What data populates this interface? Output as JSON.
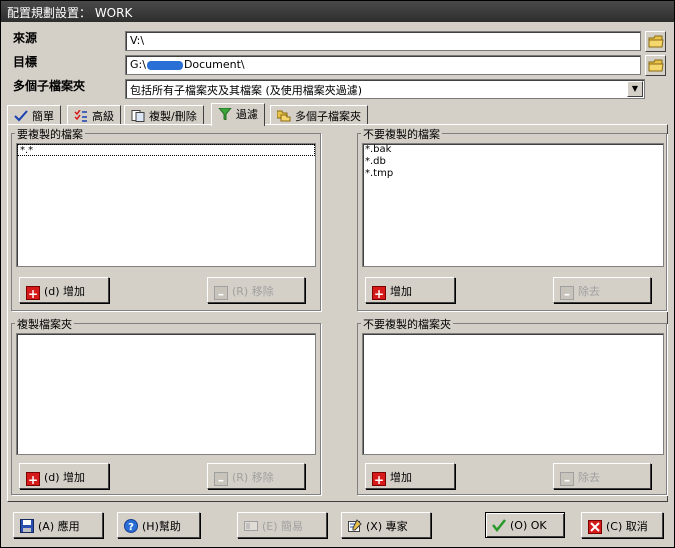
{
  "window": {
    "title": "配置規劃設置： WORK"
  },
  "source": {
    "label": "來源",
    "value": "V:\\"
  },
  "target": {
    "label": "目標",
    "value_prefix": "G:\\",
    "value_suffix": "Document\\"
  },
  "subfolders": {
    "label": "多個子檔案夾",
    "selected": "包括所有子檔案夾及其檔案 (及使用檔案夾過濾)"
  },
  "tabs": [
    {
      "label": "簡單",
      "icon": "check-icon"
    },
    {
      "label": "高級",
      "icon": "checklist-icon"
    },
    {
      "label": "複製/刪除",
      "icon": "copy-delete-icon"
    },
    {
      "label": "過濾",
      "icon": "filter-icon",
      "active": true
    },
    {
      "label": "多個子檔案夾",
      "icon": "folders-icon"
    }
  ],
  "groups": {
    "include_files": {
      "title": "要複製的檔案",
      "items": [
        "*.*"
      ],
      "add": "(d) 增加",
      "remove": "(R) 移除"
    },
    "exclude_files": {
      "title": "不要複製的檔案",
      "items": [
        "*.bak",
        "*.db",
        "*.tmp"
      ],
      "add": "增加",
      "remove": "除去"
    },
    "include_folders": {
      "title": "複製檔案夾",
      "items": [],
      "add": "(d) 增加",
      "remove": "(R) 移除"
    },
    "exclude_folders": {
      "title": "不要複製的檔案夾",
      "items": [],
      "add": "增加",
      "remove": "除去"
    }
  },
  "bottom_buttons": {
    "apply": "(A) 應用",
    "help": "(H)幫助",
    "simple": "(E) 簡易",
    "expert": "(X) 專家",
    "ok": "(O) OK",
    "cancel": "(C) 取消"
  }
}
